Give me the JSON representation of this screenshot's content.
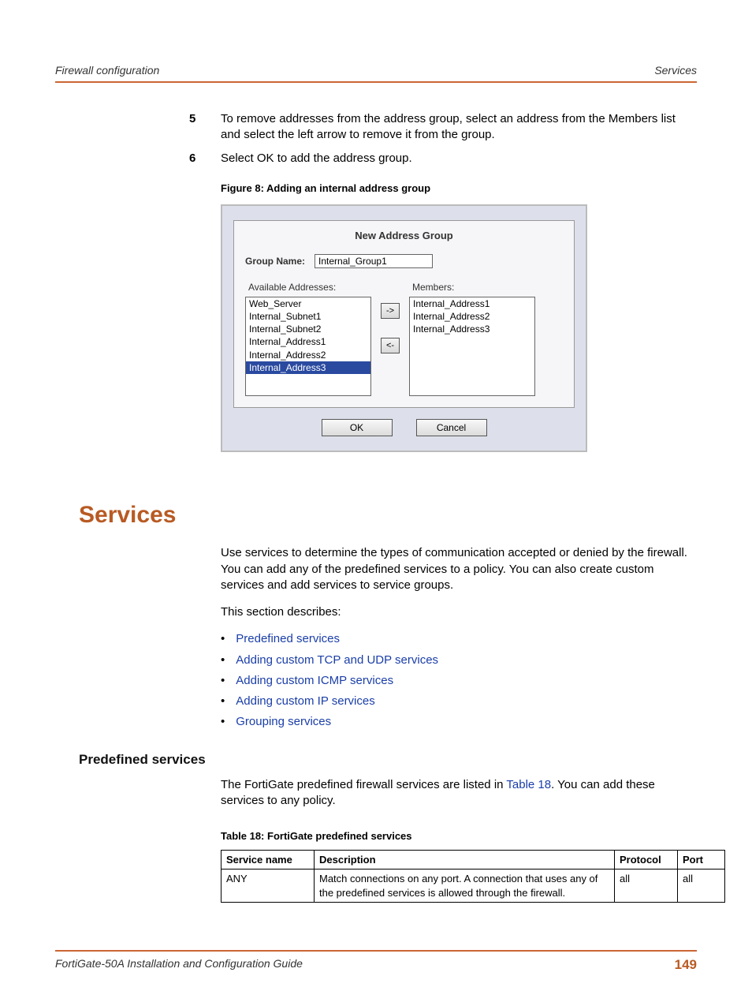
{
  "header": {
    "left": "Firewall configuration",
    "right": "Services"
  },
  "steps": [
    {
      "n": "5",
      "text": "To remove addresses from the address group, select an address from the Members list and select the left arrow to remove it from the group."
    },
    {
      "n": "6",
      "text": "Select OK to add the address group."
    }
  ],
  "figure": {
    "caption": "Figure 8:   Adding an internal address group",
    "title": "New Address Group",
    "groupNameLabel": "Group Name:",
    "groupNameValue": "Internal_Group1",
    "availableLabel": "Available Addresses:",
    "membersLabel": "Members:",
    "available": [
      "Web_Server",
      "Internal_Subnet1",
      "Internal_Subnet2",
      "Internal_Address1",
      "Internal_Address2",
      "Internal_Address3"
    ],
    "availableSelectedIndex": 5,
    "members": [
      "Internal_Address1",
      "Internal_Address2",
      "Internal_Address3"
    ],
    "arrowRight": "->",
    "arrowLeft": "<-",
    "ok": "OK",
    "cancel": "Cancel"
  },
  "section": {
    "title": "Services",
    "para1": "Use services to determine the types of communication accepted or denied by the firewall. You can add any of the predefined services to a policy. You can also create custom services and add services to service groups.",
    "para2": "This section describes:",
    "links": [
      "Predefined services",
      "Adding custom TCP and UDP services",
      "Adding custom ICMP services",
      "Adding custom IP services",
      "Grouping services"
    ]
  },
  "subsection": {
    "title": "Predefined services",
    "pre": "The FortiGate predefined firewall services are listed in ",
    "linkText": "Table 18",
    "post": ". You can add these services to any policy."
  },
  "table": {
    "caption": "Table 18: FortiGate predefined services",
    "headers": [
      "Service name",
      "Description",
      "Protocol",
      "Port"
    ],
    "rows": [
      {
        "c0": "ANY",
        "c1": "Match connections on any port. A connection that uses any of the predefined services is allowed through the firewall.",
        "c2": "all",
        "c3": "all"
      }
    ]
  },
  "footer": {
    "guide": "FortiGate-50A Installation and Configuration Guide",
    "page": "149"
  }
}
